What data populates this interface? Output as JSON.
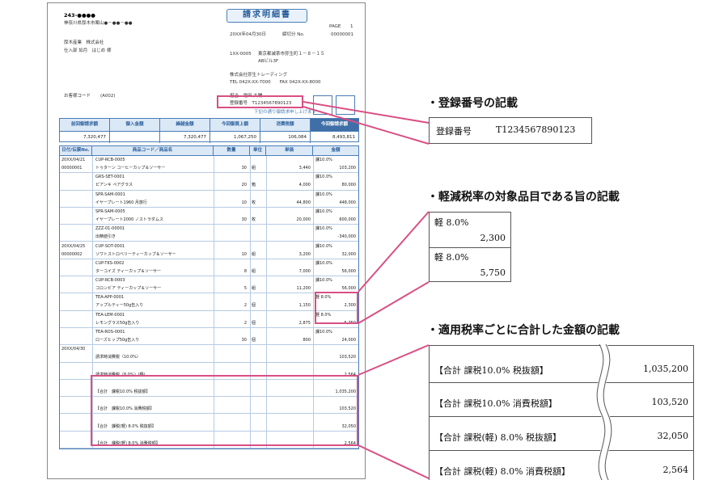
{
  "invoice": {
    "title": "請求明細書",
    "postal": "243-●●●●",
    "address": "神奈川県厚木市案山●－●●－●●",
    "customer_company": "厚木産業　株式会社",
    "customer_person": "仕入部 如月　はじめ 様",
    "page_label": "PAGE",
    "page_no": "1",
    "date": "20XX年04月30日",
    "closing_label": "締切分 No.",
    "closing_no": "00000001",
    "sender_postal": "1XX-0005",
    "sender_address": "東京都滅茶市弥生町１－８－１５",
    "sender_building": "ABビル3F",
    "sender_company": "株式会社弥生トレーディング",
    "sender_tel": "TEL 042X-XX-7000　　FAX 042X-XX-8000",
    "staff": "担当　霜田 大輔",
    "reg_no": "登録番号　T1234567890123",
    "customer_code_label": "お客様コード",
    "customer_code": "(A002)",
    "notice": "下記の通り御請求申し上げます",
    "summary_headers": [
      "前回御請求額",
      "御入金額",
      "繰越金額",
      "今回御買上額",
      "消費税額",
      "今回御請求額"
    ],
    "summary_values": [
      "7,320,477",
      "",
      "7,320,477",
      "1,067,250",
      "106,084",
      "8,493,811"
    ],
    "detail_headers": [
      "日付/伝票No.",
      "商品コード／商品名",
      "数量",
      "単位",
      "単価",
      "金額"
    ],
    "rows": [
      {
        "date": "20XX/04/21",
        "slip": "00000001",
        "code": "CUP-RCB-0005",
        "name": "トゥターン コーヒーカップ＆ソーサー",
        "qty": "30",
        "unit": "組",
        "price": "3,440",
        "tax": "課10.0%",
        "amount": "103,200"
      },
      {
        "date": "",
        "slip": "",
        "code": "GRS-SET-0001",
        "name": "ピアンキ ペアグラス",
        "qty": "20",
        "unit": "箱",
        "price": "4,000",
        "tax": "課10.0%",
        "amount": "80,000"
      },
      {
        "date": "",
        "slip": "",
        "code": "SPR-SAM-0001",
        "name": "イヤープレート1960 月旅行",
        "qty": "10",
        "unit": "枚",
        "price": "44,800",
        "tax": "課10.0%",
        "amount": "448,000"
      },
      {
        "date": "",
        "slip": "",
        "code": "SPR-SAM-0005",
        "name": "イヤープレート2000 ノストラダムス",
        "qty": "30",
        "unit": "枚",
        "price": "20,000",
        "tax": "課10.0%",
        "amount": "600,000"
      },
      {
        "date": "",
        "slip": "",
        "code": "ZZZ-01-00001",
        "name": "出精値引き",
        "qty": "",
        "unit": "",
        "price": "",
        "tax": "課10.0%",
        "amount": "-340,000"
      },
      {
        "date": "20XX/04/25",
        "slip": "00000002",
        "code": "CUP-SOT-0001",
        "name": "ソワトストロベリーティーカップ＆ソーサー",
        "qty": "10",
        "unit": "組",
        "price": "3,200",
        "tax": "課10.0%",
        "amount": "32,000"
      },
      {
        "date": "",
        "slip": "",
        "code": "CUP-TKS-0002",
        "name": "ターコイズ ティーカップ＆ソーサー",
        "qty": "8",
        "unit": "組",
        "price": "7,000",
        "tax": "課10.0%",
        "amount": "56,000"
      },
      {
        "date": "",
        "slip": "",
        "code": "CUP-RCB-0003",
        "name": "コロンビア ティーカップ＆ソーサー",
        "qty": "5",
        "unit": "組",
        "price": "11,200",
        "tax": "課10.0%",
        "amount": "56,000"
      },
      {
        "date": "",
        "slip": "",
        "code": "TEA-APP-0001",
        "name": "アップルティー50g缶入り",
        "qty": "2",
        "unit": "個",
        "price": "1,150",
        "tax": "軽 8.0%",
        "amount": "2,300"
      },
      {
        "date": "",
        "slip": "",
        "code": "TEA-LEM-0001",
        "name": "レモングラス50g缶入り",
        "qty": "2",
        "unit": "個",
        "price": "2,875",
        "tax": "軽 8.0%",
        "amount": "5,750"
      },
      {
        "date": "",
        "slip": "",
        "code": "TEA-ROS-0001",
        "name": "ローズヒップ50g缶入り",
        "qty": "30",
        "unit": "個",
        "price": "800",
        "tax": "課10.0%",
        "amount": "24,000"
      },
      {
        "date": "20XX/04/30",
        "slip": "",
        "code": "",
        "name": "請求時消費税〈10.0%〉",
        "qty": "",
        "unit": "",
        "price": "",
        "tax": "",
        "amount": "103,520"
      },
      {
        "date": "",
        "slip": "",
        "code": "",
        "name": "請求時消費税〈8.0%〉(軽)",
        "qty": "",
        "unit": "",
        "price": "",
        "tax": "",
        "amount": "2,564"
      },
      {
        "date": "",
        "slip": "",
        "code": "",
        "name": "【合計　課税10.0% 税抜額】",
        "qty": "",
        "unit": "",
        "price": "",
        "tax": "",
        "amount": "1,035,200"
      },
      {
        "date": "",
        "slip": "",
        "code": "",
        "name": "【合計　課税10.0% 消費税額】",
        "qty": "",
        "unit": "",
        "price": "",
        "tax": "",
        "amount": "103,520"
      },
      {
        "date": "",
        "slip": "",
        "code": "",
        "name": "【合計　課税(軽) 8.0% 税抜額】",
        "qty": "",
        "unit": "",
        "price": "",
        "tax": "",
        "amount": "32,050"
      },
      {
        "date": "",
        "slip": "",
        "code": "",
        "name": "【合計　課税(軽) 8.0% 消費税額】",
        "qty": "",
        "unit": "",
        "price": "",
        "tax": "",
        "amount": "2,564"
      }
    ]
  },
  "callouts": {
    "reg": {
      "title": "・登録番号の記載",
      "label": "登録番号",
      "value": "T1234567890123"
    },
    "reduced": {
      "title": "・軽減税率の対象品目である旨の記載",
      "items": [
        {
          "rate": "軽 8.0%",
          "amount": "2,300"
        },
        {
          "rate": "軽 8.0%",
          "amount": "5,750"
        }
      ]
    },
    "totals": {
      "title": "・適用税率ごとに合計した金額の記載",
      "items": [
        {
          "label": "【合計 課税10.0% 税抜額】",
          "amount": "1,035,200"
        },
        {
          "label": "【合計 課税10.0% 消費税額】",
          "amount": "103,520"
        },
        {
          "label": "【合計 課税(軽) 8.0% 税抜額】",
          "amount": "32,050"
        },
        {
          "label": "【合計 課税(軽) 8.0% 消費税額】",
          "amount": "2,564"
        }
      ]
    }
  },
  "colors": {
    "accent_blue": "#4a7db5",
    "highlight_pink": "#d94f84"
  }
}
